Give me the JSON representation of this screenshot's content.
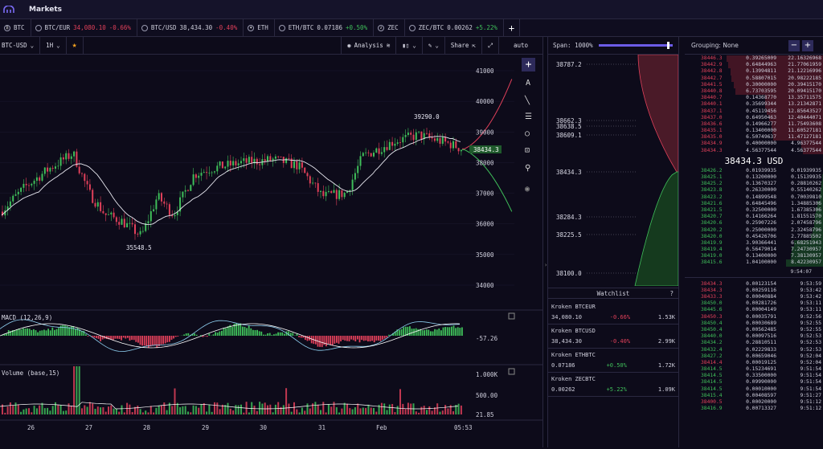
{
  "app": {
    "title": "Markets"
  },
  "tickers": [
    {
      "icon": "btc-icon",
      "label": "BTC",
      "price": "",
      "change": ""
    },
    {
      "icon": "",
      "label": "BTC/EUR",
      "price": "34,080.10",
      "change": "-0.66%",
      "dir": "neg"
    },
    {
      "icon": "",
      "label": "BTC/USD",
      "price": "38,434.30",
      "change": "-0.40%",
      "dir": "neg"
    },
    {
      "icon": "eth-icon",
      "label": "ETH",
      "price": "",
      "change": ""
    },
    {
      "icon": "",
      "label": "ETH/BTC",
      "price": "0.07186",
      "change": "+0.50%",
      "dir": "pos"
    },
    {
      "icon": "zec-icon",
      "label": "ZEC",
      "price": "",
      "change": ""
    },
    {
      "icon": "",
      "label": "ZEC/BTC",
      "price": "0.00262",
      "change": "+5.22%",
      "dir": "pos"
    }
  ],
  "toolbar": {
    "pair": "BTC-USD",
    "interval": "1H",
    "analysis": "Analysis",
    "share": "Share",
    "auto": "auto"
  },
  "chart": {
    "price_ticks": [
      "41000",
      "40000",
      "39000",
      "38000",
      "37000",
      "36000",
      "35000",
      "34000"
    ],
    "last_price": "38434.3",
    "high_label": "39290.0",
    "low_label": "35548.5",
    "macd_label": "MACD (12,26,9)",
    "macd_value": "-57.26",
    "volume_label": "Volume (base,15)",
    "volume_ticks": [
      "1.000K",
      "500.00",
      "21.85"
    ],
    "x_labels": [
      "26",
      "27",
      "28",
      "29",
      "30",
      "31",
      "Feb",
      "05:53"
    ]
  },
  "depth": {
    "span_label": "Span: 1000%",
    "prices": [
      "38787.2",
      "38662.3",
      "38638.5",
      "38609.1",
      "38434.3",
      "38284.3",
      "38225.5",
      "38100.0"
    ]
  },
  "watchlist": {
    "title": "Watchlist",
    "help": "?",
    "items": [
      {
        "name": "Kroken BTCEUR",
        "price": "34,080.10",
        "change": "-0.66%",
        "dir": "neg",
        "vol": "1.53K"
      },
      {
        "name": "Kroken BTCUSD",
        "price": "38,434.30",
        "change": "-0.40%",
        "dir": "neg",
        "vol": "2.99K"
      },
      {
        "name": "Kroken ETHBTC",
        "price": "0.07186",
        "change": "+0.50%",
        "dir": "pos",
        "vol": "1.72K"
      },
      {
        "name": "Kroken ZECBTC",
        "price": "0.00262",
        "change": "+5.22%",
        "dir": "pos",
        "vol": "1.09K"
      }
    ]
  },
  "orderbook": {
    "grouping": "Grouping: None",
    "mid": "38434.3 USD",
    "time": "9:54:07",
    "asks": [
      [
        "38446.3",
        "0.39265009",
        "22.16326968"
      ],
      [
        "38442.9",
        "0.64844963",
        "21.77061959"
      ],
      [
        "38442.8",
        "0.13994811",
        "21.12216996"
      ],
      [
        "38442.7",
        "0.58807015",
        "20.98222185"
      ],
      [
        "38441.5",
        "0.30000000",
        "20.39415170"
      ],
      [
        "38440.8",
        "6.73703595",
        "20.09415170"
      ],
      [
        "38440.7",
        "0.14368770",
        "13.35711575"
      ],
      [
        "38440.1",
        "0.35699344",
        "13.21342871"
      ],
      [
        "38437.1",
        "0.45119456",
        "12.85643527"
      ],
      [
        "38437.0",
        "0.64950463",
        "12.40444071"
      ],
      [
        "38436.6",
        "0.14966277",
        "11.75493608"
      ],
      [
        "38435.1",
        "0.13400000",
        "11.60527181"
      ],
      [
        "38435.0",
        "6.50749637",
        "11.47127181"
      ],
      [
        "38434.9",
        "0.40000000",
        "4.96377544"
      ],
      [
        "38434.3",
        "4.56377544",
        "4.56377544"
      ]
    ],
    "bids": [
      [
        "38426.2",
        "0.01939935",
        "0.01939935"
      ],
      [
        "38425.1",
        "0.13200000",
        "0.15139935"
      ],
      [
        "38425.2",
        "0.13670327",
        "0.28810262"
      ],
      [
        "38423.8",
        "0.26330000",
        "0.55140262"
      ],
      [
        "38423.2",
        "0.14899548",
        "0.70039810"
      ],
      [
        "38421.6",
        "0.64845496",
        "1.34885306"
      ],
      [
        "38421.5",
        "0.32500000",
        "1.67385306"
      ],
      [
        "38420.7",
        "0.14166264",
        "1.81551570"
      ],
      [
        "38420.6",
        "0.25907226",
        "2.07458796"
      ],
      [
        "38420.2",
        "0.25000000",
        "2.32458796"
      ],
      [
        "38420.0",
        "0.45426706",
        "2.77885502"
      ],
      [
        "38419.9",
        "3.90366441",
        "6.68251943"
      ],
      [
        "38419.4",
        "0.56479014",
        "7.24730957"
      ],
      [
        "38419.0",
        "0.13400000",
        "7.38130957"
      ],
      [
        "38415.6",
        "1.04100000",
        "8.42230957"
      ]
    ],
    "trades": [
      [
        "38434.3",
        "0.00123154",
        "9:53:59",
        "neg"
      ],
      [
        "38434.3",
        "0.00259116",
        "9:53:42",
        "neg"
      ],
      [
        "38433.3",
        "0.00040884",
        "9:53:42",
        "neg"
      ],
      [
        "38450.0",
        "0.00281726",
        "9:53:11",
        "pos"
      ],
      [
        "38445.6",
        "0.00004149",
        "9:53:11",
        "pos"
      ],
      [
        "38450.3",
        "0.00035791",
        "9:52:56",
        "neg"
      ],
      [
        "38450.4",
        "0.00030689",
        "9:52:55",
        "pos"
      ],
      [
        "38450.4",
        "0.00562485",
        "9:52:55",
        "pos"
      ],
      [
        "38440.0",
        "0.00097516",
        "9:52:53",
        "pos"
      ],
      [
        "38434.2",
        "0.28810511",
        "9:52:53",
        "pos"
      ],
      [
        "38432.4",
        "0.02229833",
        "9:52:53",
        "pos"
      ],
      [
        "38427.2",
        "0.00659046",
        "9:52:04",
        "pos"
      ],
      [
        "38414.4",
        "0.00019125",
        "9:52:04",
        "neg"
      ],
      [
        "38414.5",
        "0.15234691",
        "9:51:54",
        "pos"
      ],
      [
        "38414.5",
        "0.33500000",
        "9:51:54",
        "pos"
      ],
      [
        "38414.5",
        "0.09990000",
        "9:51:54",
        "pos"
      ],
      [
        "38414.5",
        "0.00010000",
        "9:51:54",
        "pos"
      ],
      [
        "38415.4",
        "0.00408597",
        "9:51:27",
        "pos"
      ],
      [
        "38400.5",
        "0.00020000",
        "9:51:12",
        "neg"
      ],
      [
        "38416.9",
        "0.00713327",
        "9:51:12",
        "pos"
      ]
    ]
  }
}
